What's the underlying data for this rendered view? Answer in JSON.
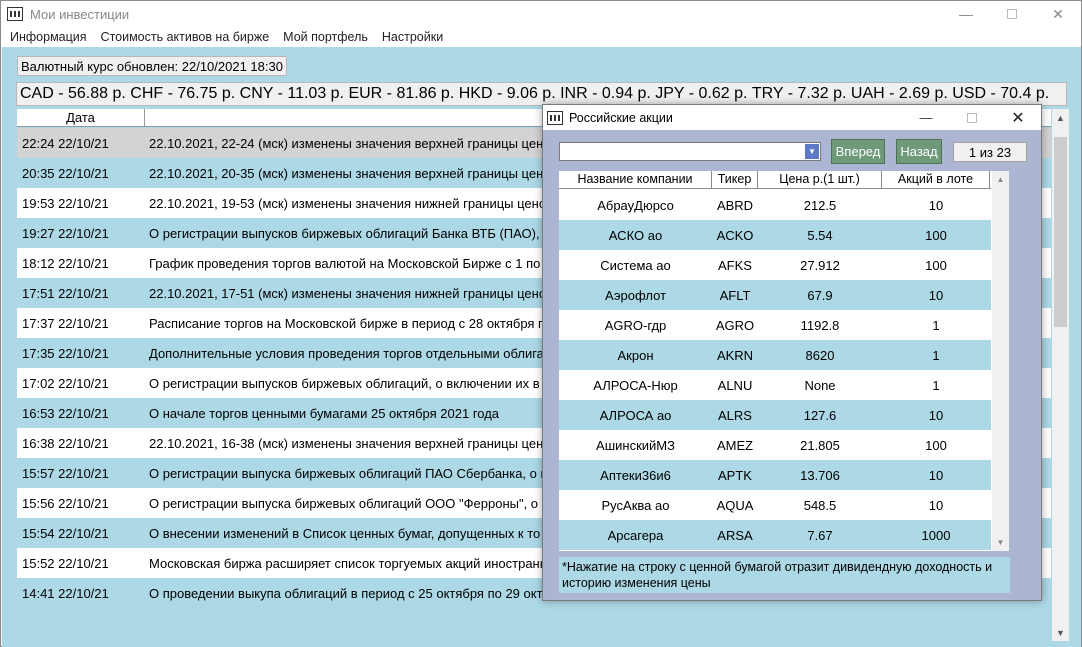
{
  "main_window": {
    "title": "Мои инвестиции",
    "controls": {
      "minimize": "—",
      "maximize": "",
      "close": "✕"
    }
  },
  "menu": [
    "Информация",
    "Стоимость активов на бирже",
    "Мой портфель",
    "Настройки"
  ],
  "rate_updated": "Валютный курс обновлен: 22/10/2021 18:30",
  "currency_strip": "CAD - 56.88 р.  CHF - 76.75 р.  CNY - 11.03 р.  EUR - 81.86 р.  HKD - 9.06 р.  INR - 0.94 р.  JPY - 0.62 р.  TRY - 7.32 р.  UAH - 2.69 р.  USD - 70.4 р.",
  "news": {
    "headers": {
      "date": "Дата",
      "title": ""
    },
    "rows": [
      {
        "date": "22:24 22/10/21",
        "text": "22.10.2021, 22-24 (мск) изменены значения верхней границы цено"
      },
      {
        "date": "20:35 22/10/21",
        "text": "22.10.2021, 20-35 (мск) изменены значения верхней границы цено"
      },
      {
        "date": "19:53 22/10/21",
        "text": "22.10.2021, 19-53 (мск) изменены значения нижней границы ценов"
      },
      {
        "date": "19:27 22/10/21",
        "text": "О регистрации выпусков биржевых облигаций Банка ВТБ (ПАО), о"
      },
      {
        "date": "18:12 22/10/21",
        "text": "График проведения торгов валютой на Московской Бирже с 1 по"
      },
      {
        "date": "17:51 22/10/21",
        "text": "22.10.2021, 17-51 (мск) изменены значения нижней границы ценов"
      },
      {
        "date": "17:37 22/10/21",
        "text": "Расписание торгов на Московской бирже в период с 28 октября п"
      },
      {
        "date": "17:35 22/10/21",
        "text": "Дополнительные условия проведения торгов отдельными облигац"
      },
      {
        "date": "17:02 22/10/21",
        "text": "О регистрации выпусков биржевых облигаций, о включении их в"
      },
      {
        "date": "16:53 22/10/21",
        "text": "О начале торгов ценными бумагами 25 октября 2021 года"
      },
      {
        "date": "16:38 22/10/21",
        "text": "22.10.2021, 16-38 (мск) изменены значения верхней границы цено"
      },
      {
        "date": "15:57 22/10/21",
        "text": "О регистрации выпуска биржевых облигаций ПАО Сбербанка, о в"
      },
      {
        "date": "15:56 22/10/21",
        "text": "О регистрации выпуска биржевых облигаций ООО \"Ферроны\", о в"
      },
      {
        "date": "15:54 22/10/21",
        "text": "О внесении изменений в Список ценных бумаг, допущенных к то"
      },
      {
        "date": "15:52 22/10/21",
        "text": "Московская биржа расширяет список торгуемых акций иностранн"
      },
      {
        "date": "14:41 22/10/21",
        "text": "О проведении выкупа облигаций в период с 25 октября по 29 октя"
      }
    ]
  },
  "dialog": {
    "title": "Российские акции",
    "controls": {
      "minimize": "—",
      "maximize": "",
      "close": "✕"
    },
    "search": {
      "value": "",
      "placeholder": ""
    },
    "forward_label": "Вперед",
    "back_label": "Назад",
    "page_indicator": "1 из 23",
    "table_headers": {
      "name": "Название компании",
      "ticker": "Тикер",
      "price": "Цена р.(1 шт.)",
      "lot": "Акций в лоте"
    },
    "stocks": [
      {
        "name": "АбрауДюрсо",
        "ticker": "ABRD",
        "price": "212.5",
        "lot": "10"
      },
      {
        "name": "АСКО ао",
        "ticker": "ACKO",
        "price": "5.54",
        "lot": "100"
      },
      {
        "name": "Система ао",
        "ticker": "AFKS",
        "price": "27.912",
        "lot": "100"
      },
      {
        "name": "Аэрофлот",
        "ticker": "AFLT",
        "price": "67.9",
        "lot": "10"
      },
      {
        "name": "AGRO-гдр",
        "ticker": "AGRO",
        "price": "1192.8",
        "lot": "1"
      },
      {
        "name": "Акрон",
        "ticker": "AKRN",
        "price": "8620",
        "lot": "1"
      },
      {
        "name": "АЛРОСА-Нюр",
        "ticker": "ALNU",
        "price": "None",
        "lot": "1"
      },
      {
        "name": "АЛРОСА ао",
        "ticker": "ALRS",
        "price": "127.6",
        "lot": "10"
      },
      {
        "name": "АшинскийМЗ",
        "ticker": "AMEZ",
        "price": "21.805",
        "lot": "100"
      },
      {
        "name": "Аптеки36и6",
        "ticker": "APTK",
        "price": "13.706",
        "lot": "10"
      },
      {
        "name": "РусАква ао",
        "ticker": "AQUA",
        "price": "548.5",
        "lot": "10"
      },
      {
        "name": "Арсагера",
        "ticker": "ARSA",
        "price": "7.67",
        "lot": "1000"
      }
    ],
    "note": "*Нажатие на строку с ценной бумагой отразит дивидендную доходность и историю изменения цены"
  }
}
